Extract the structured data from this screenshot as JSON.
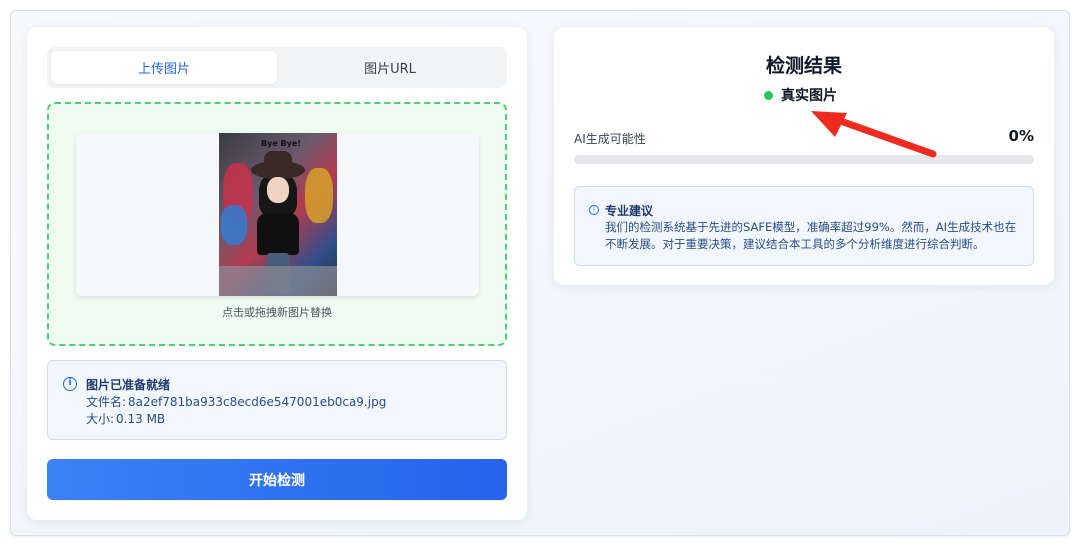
{
  "tabs": [
    {
      "label": "上传图片",
      "active": true
    },
    {
      "label": "图片URL",
      "active": false
    }
  ],
  "dropzone": {
    "hint": "点击或拖拽新图片替换",
    "photo_caption": "Bye Bye!",
    "border_color": "#4ccf6f"
  },
  "file_info": {
    "title": "图片已准备就绪",
    "icon": "info-icon",
    "filename_label": "文件名:",
    "filename": "8a2ef781ba933c8ecd6e547001eb0ca9.jpg",
    "size_label": "大小:",
    "size": "0.13 MB"
  },
  "start_button": {
    "label": "开始检测"
  },
  "result": {
    "title": "检测结果",
    "status": "真实图片",
    "status_color": "#22c55e",
    "probability_label": "AI生成可能性",
    "probability_value": "0%",
    "probability_fraction": 0
  },
  "advice": {
    "title": "专业建议",
    "icon": "info-icon",
    "text": "我们的检测系统基于先进的SAFE模型，准确率超过99%。然而，AI生成技术也在不断发展。对于重要决策，建议结合本工具的多个分析维度进行综合判断。"
  },
  "annotation": {
    "arrow_color": "#ef2b1f"
  }
}
